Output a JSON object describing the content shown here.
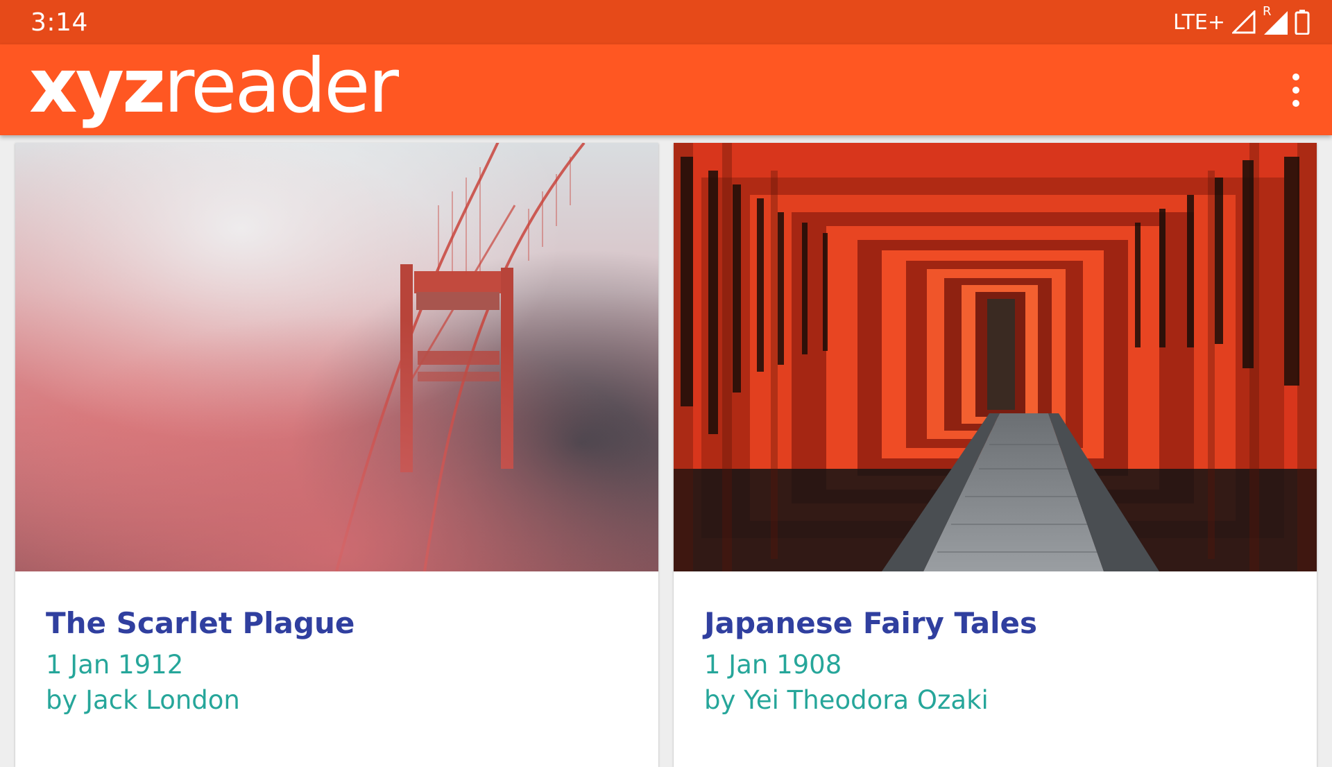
{
  "status_bar": {
    "time": "3:14",
    "network": "LTE+",
    "roaming": "R",
    "icons": [
      "signal-icon",
      "roaming-signal-icon",
      "battery-icon"
    ],
    "color": "#e64a19"
  },
  "app_bar": {
    "logo_bold": "xyz",
    "logo_light": "reader",
    "color": "#ff5722",
    "menu_icon": "overflow-menu-icon"
  },
  "articles": [
    {
      "title": "The Scarlet Plague",
      "date": "1 Jan 1912",
      "author": "by Jack London",
      "image": "golden-gate-bridge-fog-photo"
    },
    {
      "title": "Japanese Fairy Tales",
      "date": "1 Jan 1908",
      "author": "by Yei Theodora Ozaki",
      "image": "torii-gates-tunnel-photo"
    }
  ],
  "colors": {
    "title": "#303f9f",
    "meta": "#26a69a"
  }
}
